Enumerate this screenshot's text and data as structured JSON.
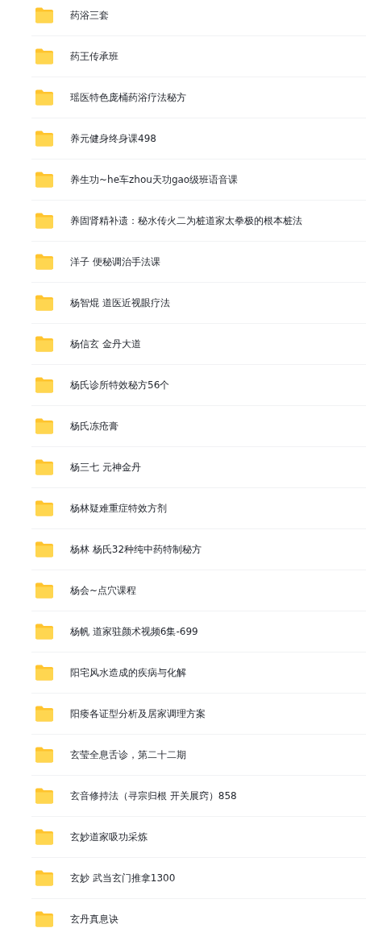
{
  "folders": [
    {
      "name": "药浴三套"
    },
    {
      "name": "药王传承班"
    },
    {
      "name": "瑶医特色庞桶药浴疗法秘方"
    },
    {
      "name": "养元健身终身课498"
    },
    {
      "name": "养生功~he车zhou天功gao级班语音课"
    },
    {
      "name": "养固肾精补遗：秘水传火二为桩道家太拳极的根本桩法"
    },
    {
      "name": "洋子 便秘调治手法课"
    },
    {
      "name": "杨智焜 道医近视眼疗法"
    },
    {
      "name": "杨信玄 金丹大道"
    },
    {
      "name": "杨氏诊所特效秘方56个"
    },
    {
      "name": "杨氏冻疮膏"
    },
    {
      "name": "杨三七 元神金丹"
    },
    {
      "name": "杨林疑难重症特效方剂"
    },
    {
      "name": "杨林 杨氏32种纯中药特制秘方"
    },
    {
      "name": "杨会~点穴课程"
    },
    {
      "name": "杨帆 道家驻颜术视频6集-699"
    },
    {
      "name": "阳宅风水造成的疾病与化解"
    },
    {
      "name": "阳痿各证型分析及居家调理方案"
    },
    {
      "name": "玄莹全息舌诊，第二十二期"
    },
    {
      "name": "玄音修持法（寻宗归根 开关展窍）858"
    },
    {
      "name": "玄妙道家吸功采炼"
    },
    {
      "name": "玄妙 武当玄门推拿1300"
    },
    {
      "name": "玄丹真息诀"
    }
  ]
}
